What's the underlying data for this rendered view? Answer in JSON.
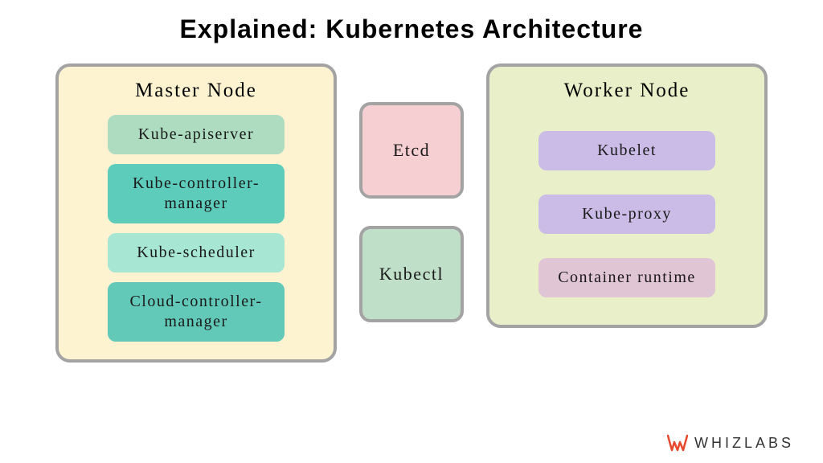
{
  "title": "Explained: Kubernetes Architecture",
  "master": {
    "title": "Master Node",
    "items": [
      "Kube-apiserver",
      "Kube-controller-manager",
      "Kube-scheduler",
      "Cloud-controller-manager"
    ]
  },
  "middle": {
    "etcd": "Etcd",
    "kubectl": "Kubectl"
  },
  "worker": {
    "title": "Worker Node",
    "items": [
      "Kubelet",
      "Kube-proxy",
      "Container runtime"
    ]
  },
  "brand": "WHIZLABS"
}
